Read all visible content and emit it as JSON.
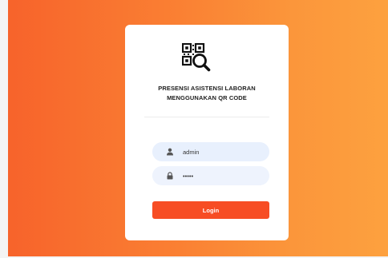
{
  "app": {
    "title_line1": "PRESENSI ASISTENSI LABORAN",
    "title_line2": "MENGGUNAKAN QR CODE",
    "logo_icon": "qr-code-search-icon"
  },
  "form": {
    "username": {
      "value": "admin",
      "icon": "user-icon"
    },
    "password": {
      "value": "•••••",
      "icon": "lock-icon"
    },
    "submit_label": "Login"
  },
  "colors": {
    "gradient_start": "#f7632b",
    "gradient_end": "#fda13f",
    "button": "#f74d24",
    "input_bg": "#e8f0fd"
  }
}
